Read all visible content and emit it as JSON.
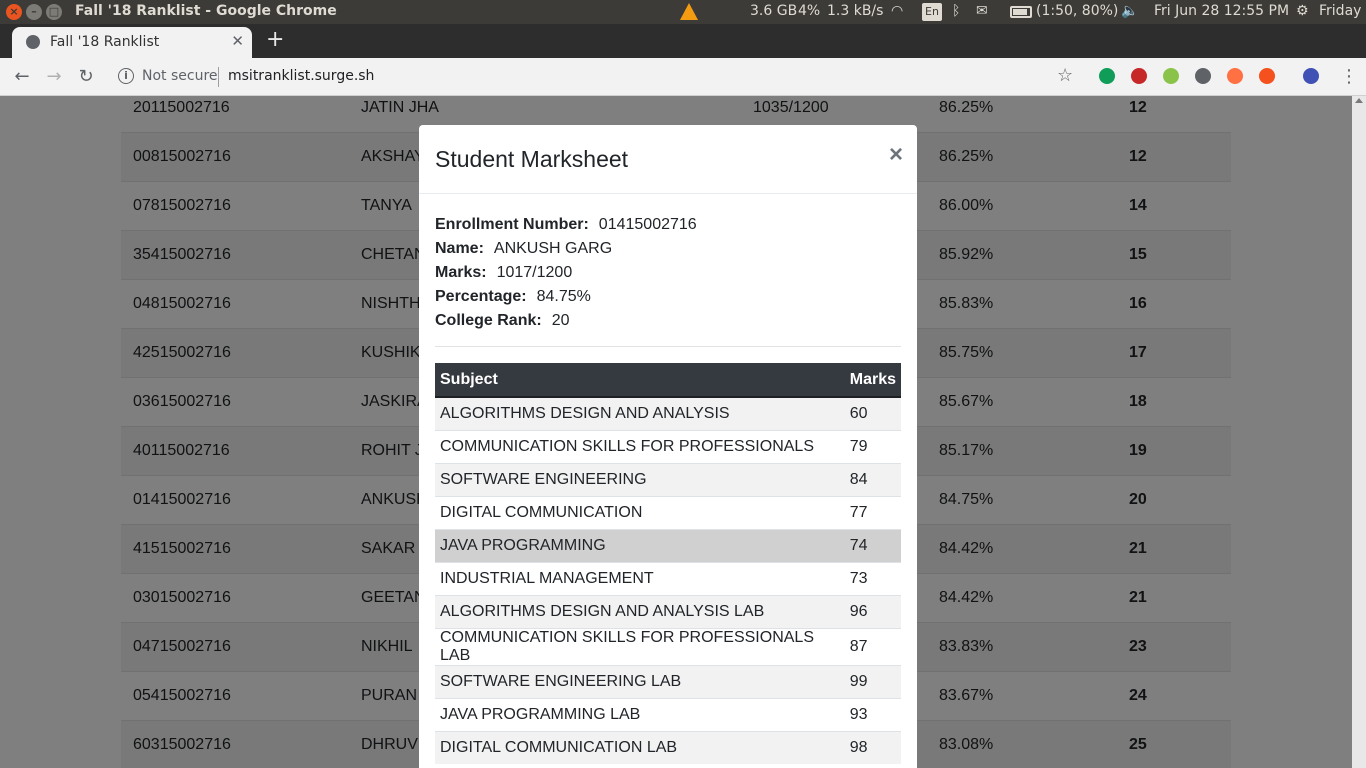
{
  "os_panel": {
    "app_title": "Fall '18 Ranklist - Google Chrome",
    "memory": "3.6 GB",
    "cpu": "4%",
    "net": "1.3 kB/s",
    "keyboard": "En",
    "battery": "(1:50, 80%)",
    "datetime": "Fri Jun 28 12:55 PM",
    "user": "Friday"
  },
  "browser": {
    "tab_title": "Fall '18 Ranklist",
    "security_label": "Not secure",
    "url": "msitranklist.surge.sh",
    "extension_colors": [
      "#0f9d58",
      "#c62828",
      "#8bc34a",
      "#5f6368",
      "#ff7043",
      "#f4511e",
      "#3f51b5"
    ]
  },
  "ranklist": {
    "rows": [
      {
        "enroll": "20115002716",
        "name": "JATIN JHA",
        "marks": "1035/1200",
        "pct": "86.25%",
        "rank": "12"
      },
      {
        "enroll": "00815002716",
        "name": "AKSHAY",
        "marks": "",
        "pct": "86.25%",
        "rank": "12"
      },
      {
        "enroll": "07815002716",
        "name": "TANYA",
        "marks": "",
        "pct": "86.00%",
        "rank": "14"
      },
      {
        "enroll": "35415002716",
        "name": "CHETAN",
        "marks": "",
        "pct": "85.92%",
        "rank": "15"
      },
      {
        "enroll": "04815002716",
        "name": "NISHTH",
        "marks": "",
        "pct": "85.83%",
        "rank": "16"
      },
      {
        "enroll": "42515002716",
        "name": "KUSHIK",
        "marks": "",
        "pct": "85.75%",
        "rank": "17"
      },
      {
        "enroll": "03615002716",
        "name": "JASKIRA",
        "marks": "",
        "pct": "85.67%",
        "rank": "18"
      },
      {
        "enroll": "40115002716",
        "name": "ROHIT J",
        "marks": "",
        "pct": "85.17%",
        "rank": "19"
      },
      {
        "enroll": "01415002716",
        "name": "ANKUSH",
        "marks": "",
        "pct": "84.75%",
        "rank": "20"
      },
      {
        "enroll": "41515002716",
        "name": "SAKAR",
        "marks": "",
        "pct": "84.42%",
        "rank": "21"
      },
      {
        "enroll": "03015002716",
        "name": "GEETAN",
        "marks": "",
        "pct": "84.42%",
        "rank": "21"
      },
      {
        "enroll": "04715002716",
        "name": "NIKHIL",
        "marks": "",
        "pct": "83.83%",
        "rank": "23"
      },
      {
        "enroll": "05415002716",
        "name": "PURAN",
        "marks": "",
        "pct": "83.67%",
        "rank": "24"
      },
      {
        "enroll": "60315002716",
        "name": "DHRUV",
        "marks": "",
        "pct": "83.08%",
        "rank": "25"
      }
    ]
  },
  "modal": {
    "title": "Student Marksheet",
    "close_label": "×",
    "fields": [
      {
        "label": "Enrollment Number:",
        "value": "01415002716"
      },
      {
        "label": "Name:",
        "value": "ANKUSH GARG"
      },
      {
        "label": "Marks:",
        "value": "1017/1200"
      },
      {
        "label": "Percentage:",
        "value": "84.75%"
      },
      {
        "label": "College Rank:",
        "value": "20"
      }
    ],
    "table_headers": {
      "subject": "Subject",
      "marks": "Marks"
    },
    "subjects": [
      {
        "subject": "ALGORITHMS DESIGN AND ANALYSIS",
        "marks": "60"
      },
      {
        "subject": "COMMUNICATION SKILLS FOR PROFESSIONALS",
        "marks": "79"
      },
      {
        "subject": "SOFTWARE ENGINEERING",
        "marks": "84"
      },
      {
        "subject": "DIGITAL COMMUNICATION",
        "marks": "77"
      },
      {
        "subject": "JAVA PROGRAMMING",
        "marks": "74"
      },
      {
        "subject": "INDUSTRIAL MANAGEMENT",
        "marks": "73"
      },
      {
        "subject": "ALGORITHMS DESIGN AND ANALYSIS LAB",
        "marks": "96"
      },
      {
        "subject": "COMMUNICATION SKILLS FOR PROFESSIONALS LAB",
        "marks": "87"
      },
      {
        "subject": "SOFTWARE ENGINEERING LAB",
        "marks": "99"
      },
      {
        "subject": "JAVA PROGRAMMING LAB",
        "marks": "93"
      },
      {
        "subject": "DIGITAL COMMUNICATION LAB",
        "marks": "98"
      }
    ],
    "hovered_row_index": 4
  }
}
